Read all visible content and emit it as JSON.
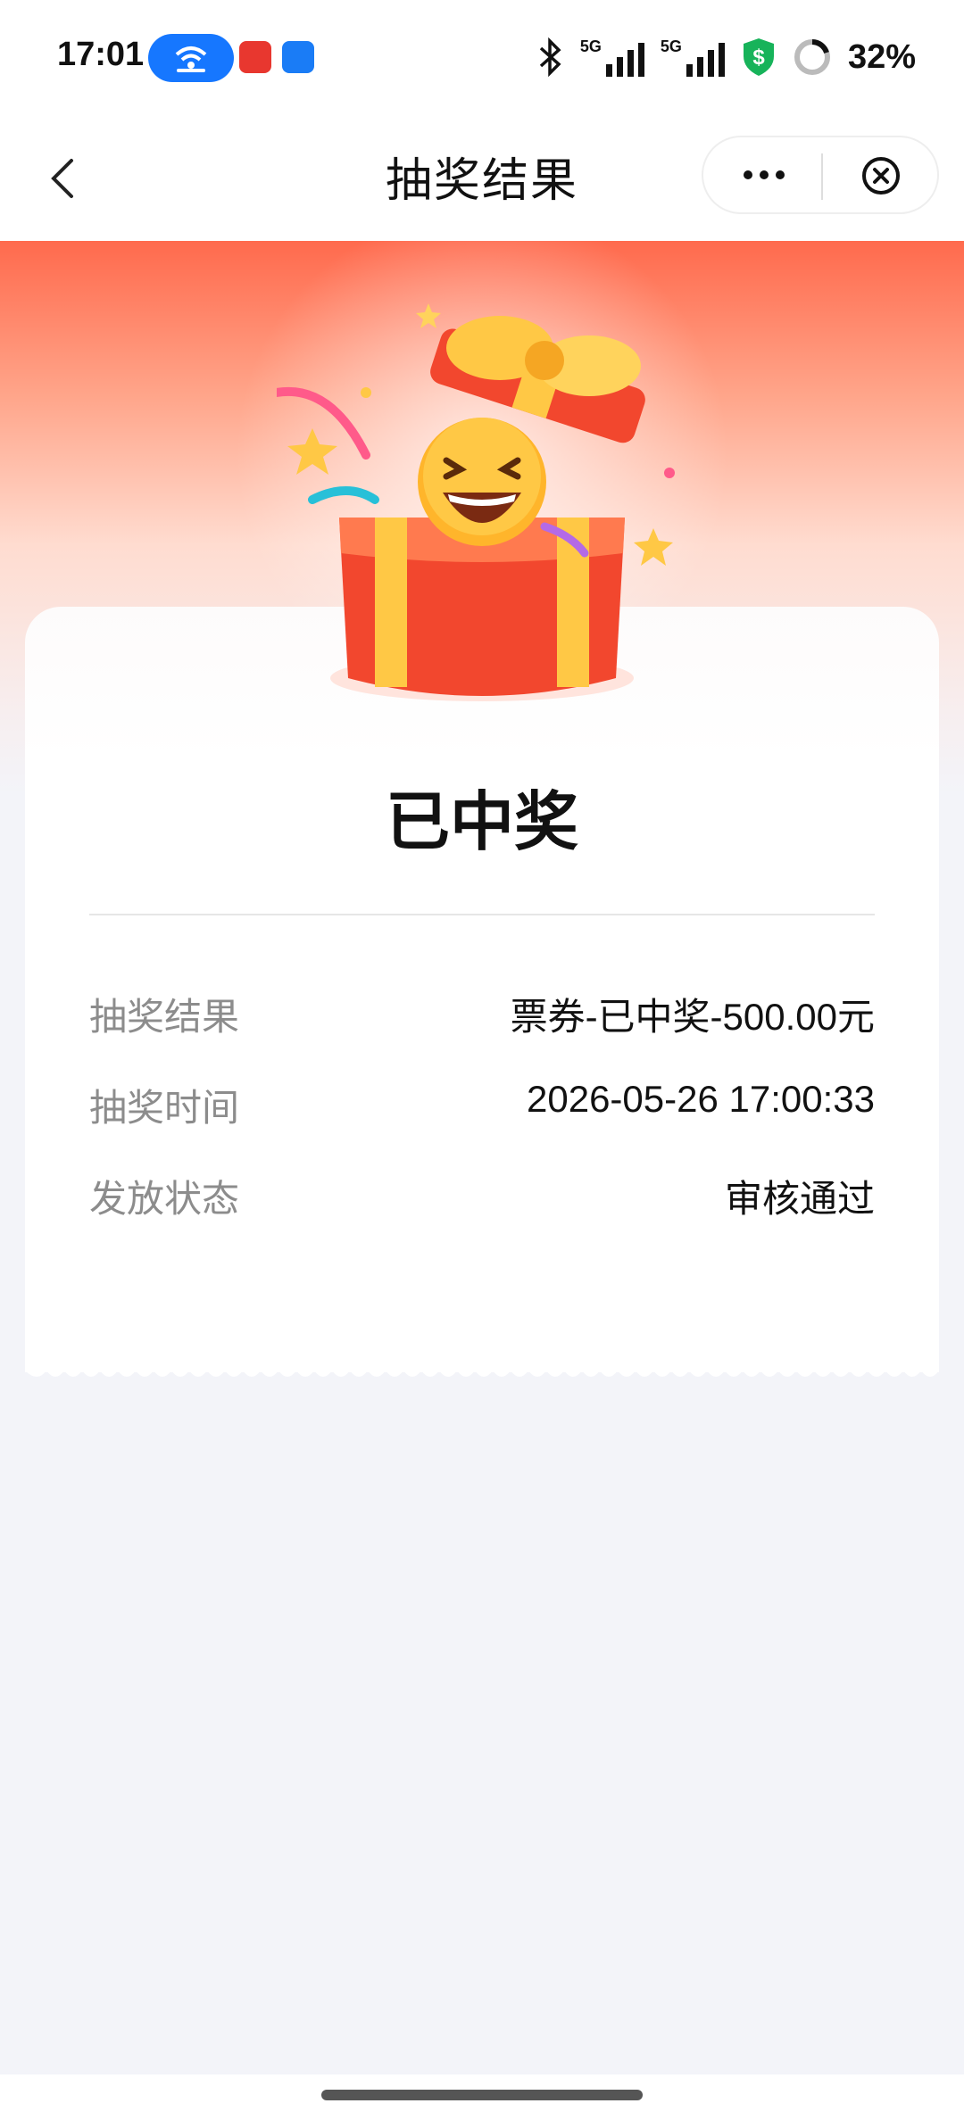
{
  "status_bar": {
    "time": "17:01",
    "battery_percent": "32%",
    "signal_labels": [
      "5G",
      "5G"
    ]
  },
  "nav": {
    "title": "抽奖结果"
  },
  "result": {
    "headline": "已中奖",
    "rows": [
      {
        "label": "抽奖结果",
        "value": "票券-已中奖-500.00元"
      },
      {
        "label": "抽奖时间",
        "value": "2026-05-26 17:00:33"
      },
      {
        "label": "发放状态",
        "value": "审核通过"
      }
    ]
  },
  "colors": {
    "accent": "#ff6a4d",
    "pill_blue": "#1677ff",
    "shield_green": "#17b35a"
  }
}
